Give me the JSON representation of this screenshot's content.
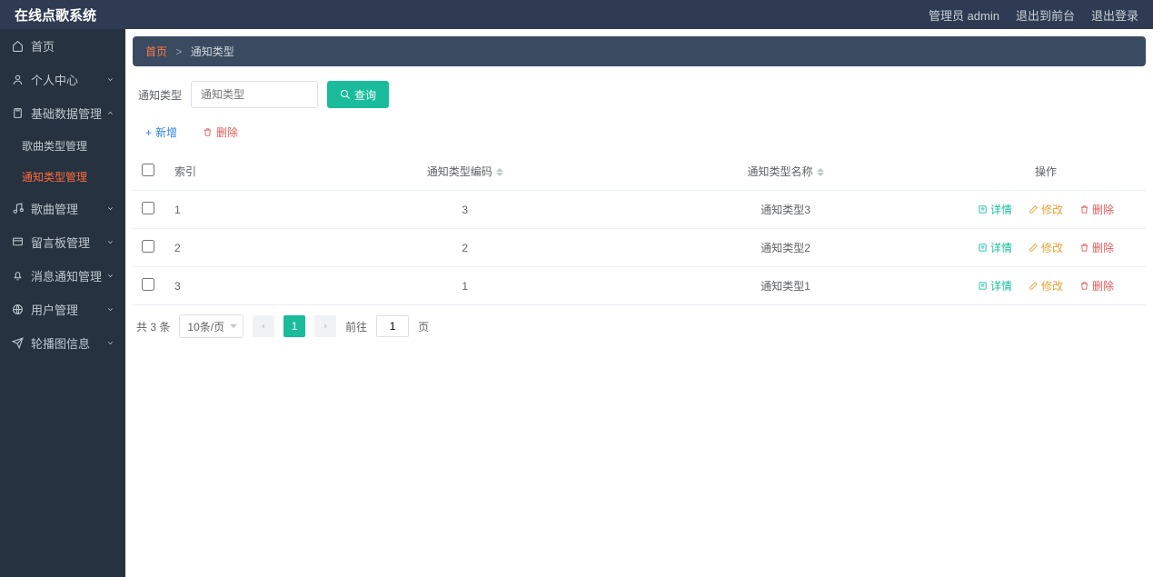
{
  "header": {
    "title": "在线点歌系统",
    "admin_label": "管理员 admin",
    "to_front": "退出到前台",
    "logout": "退出登录"
  },
  "sidebar": {
    "items": [
      {
        "icon": "home",
        "label": "首页",
        "expandable": false
      },
      {
        "icon": "user",
        "label": "个人中心",
        "expandable": true,
        "open": false
      },
      {
        "icon": "clipboard",
        "label": "基础数据管理",
        "expandable": true,
        "open": true,
        "children": [
          {
            "label": "歌曲类型管理",
            "active": false
          },
          {
            "label": "通知类型管理",
            "active": true
          }
        ]
      },
      {
        "icon": "music",
        "label": "歌曲管理",
        "expandable": true,
        "open": false
      },
      {
        "icon": "board",
        "label": "留言板管理",
        "expandable": true,
        "open": false
      },
      {
        "icon": "bell",
        "label": "消息通知管理",
        "expandable": true,
        "open": false
      },
      {
        "icon": "globe",
        "label": "用户管理",
        "expandable": true,
        "open": false
      },
      {
        "icon": "send",
        "label": "轮播图信息",
        "expandable": true,
        "open": false
      }
    ]
  },
  "breadcrumb": {
    "home": "首页",
    "current": "通知类型"
  },
  "search": {
    "label": "通知类型",
    "placeholder": "通知类型",
    "query_btn": "查询"
  },
  "actions": {
    "add": "新增",
    "delete": "删除"
  },
  "table": {
    "columns": {
      "index": "索引",
      "code": "通知类型编码",
      "name": "通知类型名称",
      "ops": "操作"
    },
    "ops": {
      "detail": "详情",
      "edit": "修改",
      "delete": "删除"
    },
    "rows": [
      {
        "index": "1",
        "code": "3",
        "name": "通知类型3"
      },
      {
        "index": "2",
        "code": "2",
        "name": "通知类型2"
      },
      {
        "index": "3",
        "code": "1",
        "name": "通知类型1"
      }
    ]
  },
  "pagination": {
    "total_prefix": "共",
    "total_count": "3",
    "total_suffix": "条",
    "per_page": "10条/页",
    "current_page": "1",
    "goto_prefix": "前往",
    "goto_value": "1",
    "goto_suffix": "页"
  }
}
